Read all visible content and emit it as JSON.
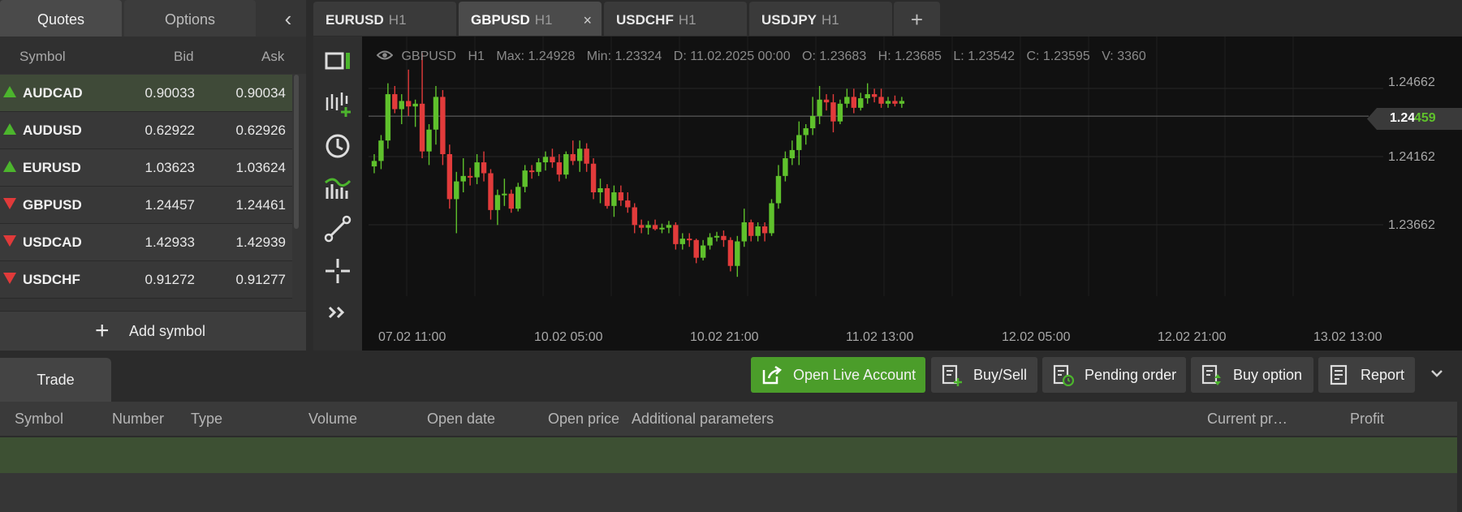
{
  "quotes": {
    "tabs": [
      "Quotes",
      "Options"
    ],
    "columns": {
      "symbol": "Symbol",
      "bid": "Bid",
      "ask": "Ask"
    },
    "rows": [
      {
        "symbol": "AUDCAD",
        "bid": "0.90033",
        "ask": "0.90034",
        "dir": "up"
      },
      {
        "symbol": "AUDUSD",
        "bid": "0.62922",
        "ask": "0.62926",
        "dir": "up"
      },
      {
        "symbol": "EURUSD",
        "bid": "1.03623",
        "ask": "1.03624",
        "dir": "up"
      },
      {
        "symbol": "GBPUSD",
        "bid": "1.24457",
        "ask": "1.24461",
        "dir": "down"
      },
      {
        "symbol": "USDCAD",
        "bid": "1.42933",
        "ask": "1.42939",
        "dir": "down"
      },
      {
        "symbol": "USDCHF",
        "bid": "0.91272",
        "ask": "0.91277",
        "dir": "down"
      }
    ],
    "add_symbol": "Add symbol"
  },
  "chart_tabs": [
    {
      "symbol": "EURUSD",
      "tf": "H1"
    },
    {
      "symbol": "GBPUSD",
      "tf": "H1",
      "active": true
    },
    {
      "symbol": "USDCHF",
      "tf": "H1"
    },
    {
      "symbol": "USDJPY",
      "tf": "H1"
    }
  ],
  "toolbar_icons": [
    "chart-type-icon",
    "add-indicator-icon",
    "timeframe-icon",
    "indicators-icon",
    "line-tool-icon",
    "crosshair-icon",
    "more-icon"
  ],
  "chart": {
    "info": {
      "symbol": "GBPUSD",
      "tf": "H1",
      "max": "Max: 1.24928",
      "min": "Min: 1.23324",
      "date": "D: 11.02.2025 00:00",
      "open": "O: 1.23683",
      "high": "H: 1.23685",
      "low": "L: 1.23542",
      "close": "C: 1.23595",
      "volume": "V: 3360"
    },
    "price_labels": [
      "1.24662",
      "1.24162",
      "1.23662"
    ],
    "current_price_main": "1.24",
    "current_price_tail": "459",
    "time_labels": [
      "07.02 11:00",
      "10.02 05:00",
      "10.02 21:00",
      "11.02 13:00",
      "12.02 05:00",
      "12.02 21:00",
      "13.02 13:00"
    ],
    "colors": {
      "up": "#5fc12c",
      "down": "#e23b3b",
      "bg": "#111111"
    }
  },
  "chart_data": {
    "type": "candlestick",
    "title": "",
    "ylim": [
      1.232,
      1.2495
    ],
    "yticks": [
      1.24662,
      1.24162,
      1.23662
    ],
    "current_price": 1.24459,
    "candles": [
      {
        "o": 1.2409,
        "h": 1.2418,
        "l": 1.2404,
        "c": 1.2413
      },
      {
        "o": 1.2413,
        "h": 1.2432,
        "l": 1.2407,
        "c": 1.2428
      },
      {
        "o": 1.2428,
        "h": 1.247,
        "l": 1.2422,
        "c": 1.2462
      },
      {
        "o": 1.2462,
        "h": 1.2468,
        "l": 1.2448,
        "c": 1.2451
      },
      {
        "o": 1.2451,
        "h": 1.2462,
        "l": 1.244,
        "c": 1.2457
      },
      {
        "o": 1.2457,
        "h": 1.248,
        "l": 1.2446,
        "c": 1.2453
      },
      {
        "o": 1.2453,
        "h": 1.2458,
        "l": 1.2438,
        "c": 1.2455
      },
      {
        "o": 1.2455,
        "h": 1.2492,
        "l": 1.2415,
        "c": 1.242
      },
      {
        "o": 1.242,
        "h": 1.244,
        "l": 1.241,
        "c": 1.2436
      },
      {
        "o": 1.2436,
        "h": 1.2468,
        "l": 1.2425,
        "c": 1.246
      },
      {
        "o": 1.246,
        "h": 1.2465,
        "l": 1.241,
        "c": 1.2418
      },
      {
        "o": 1.2418,
        "h": 1.2425,
        "l": 1.2378,
        "c": 1.2385
      },
      {
        "o": 1.2385,
        "h": 1.2405,
        "l": 1.236,
        "c": 1.2398
      },
      {
        "o": 1.2398,
        "h": 1.2415,
        "l": 1.239,
        "c": 1.2402
      },
      {
        "o": 1.2402,
        "h": 1.2408,
        "l": 1.2395,
        "c": 1.2401
      },
      {
        "o": 1.2401,
        "h": 1.2418,
        "l": 1.2396,
        "c": 1.2412
      },
      {
        "o": 1.2412,
        "h": 1.242,
        "l": 1.2398,
        "c": 1.2404
      },
      {
        "o": 1.2404,
        "h": 1.2407,
        "l": 1.237,
        "c": 1.2377
      },
      {
        "o": 1.2377,
        "h": 1.2392,
        "l": 1.2366,
        "c": 1.2388
      },
      {
        "o": 1.2388,
        "h": 1.24,
        "l": 1.238,
        "c": 1.2389
      },
      {
        "o": 1.2389,
        "h": 1.2392,
        "l": 1.2375,
        "c": 1.2378
      },
      {
        "o": 1.2378,
        "h": 1.2397,
        "l": 1.2376,
        "c": 1.2394
      },
      {
        "o": 1.2394,
        "h": 1.241,
        "l": 1.239,
        "c": 1.2406
      },
      {
        "o": 1.2406,
        "h": 1.241,
        "l": 1.24,
        "c": 1.2405
      },
      {
        "o": 1.2405,
        "h": 1.2415,
        "l": 1.2402,
        "c": 1.2412
      },
      {
        "o": 1.2412,
        "h": 1.242,
        "l": 1.2406,
        "c": 1.2416
      },
      {
        "o": 1.2416,
        "h": 1.2422,
        "l": 1.2408,
        "c": 1.2412
      },
      {
        "o": 1.2412,
        "h": 1.2418,
        "l": 1.2398,
        "c": 1.2403
      },
      {
        "o": 1.2403,
        "h": 1.242,
        "l": 1.24,
        "c": 1.2418
      },
      {
        "o": 1.2418,
        "h": 1.2428,
        "l": 1.241,
        "c": 1.2413
      },
      {
        "o": 1.2413,
        "h": 1.2428,
        "l": 1.2405,
        "c": 1.2422
      },
      {
        "o": 1.2422,
        "h": 1.2426,
        "l": 1.2405,
        "c": 1.2411
      },
      {
        "o": 1.2411,
        "h": 1.2415,
        "l": 1.2385,
        "c": 1.239
      },
      {
        "o": 1.239,
        "h": 1.24,
        "l": 1.2382,
        "c": 1.2393
      },
      {
        "o": 1.2393,
        "h": 1.2396,
        "l": 1.2378,
        "c": 1.238
      },
      {
        "o": 1.238,
        "h": 1.2395,
        "l": 1.2372,
        "c": 1.239
      },
      {
        "o": 1.239,
        "h": 1.2395,
        "l": 1.238,
        "c": 1.2384
      },
      {
        "o": 1.2384,
        "h": 1.239,
        "l": 1.2375,
        "c": 1.2379
      },
      {
        "o": 1.2379,
        "h": 1.2382,
        "l": 1.236,
        "c": 1.2366
      },
      {
        "o": 1.2366,
        "h": 1.237,
        "l": 1.236,
        "c": 1.2364
      },
      {
        "o": 1.2364,
        "h": 1.2369,
        "l": 1.2359,
        "c": 1.2366
      },
      {
        "o": 1.2366,
        "h": 1.237,
        "l": 1.2362,
        "c": 1.2363
      },
      {
        "o": 1.2363,
        "h": 1.2367,
        "l": 1.236,
        "c": 1.2364
      },
      {
        "o": 1.2364,
        "h": 1.2369,
        "l": 1.236,
        "c": 1.2366
      },
      {
        "o": 1.2366,
        "h": 1.2368,
        "l": 1.2348,
        "c": 1.2352
      },
      {
        "o": 1.2352,
        "h": 1.236,
        "l": 1.2348,
        "c": 1.2356
      },
      {
        "o": 1.2356,
        "h": 1.236,
        "l": 1.235,
        "c": 1.2355
      },
      {
        "o": 1.2355,
        "h": 1.2356,
        "l": 1.2338,
        "c": 1.2342
      },
      {
        "o": 1.2342,
        "h": 1.2355,
        "l": 1.234,
        "c": 1.2351
      },
      {
        "o": 1.2351,
        "h": 1.236,
        "l": 1.2348,
        "c": 1.2357
      },
      {
        "o": 1.2357,
        "h": 1.2361,
        "l": 1.2354,
        "c": 1.2358
      },
      {
        "o": 1.2358,
        "h": 1.2362,
        "l": 1.235,
        "c": 1.2355
      },
      {
        "o": 1.2355,
        "h": 1.2357,
        "l": 1.2332,
        "c": 1.2336
      },
      {
        "o": 1.2336,
        "h": 1.2358,
        "l": 1.2328,
        "c": 1.2354
      },
      {
        "o": 1.2354,
        "h": 1.2378,
        "l": 1.235,
        "c": 1.2368
      },
      {
        "o": 1.2368,
        "h": 1.237,
        "l": 1.2354,
        "c": 1.2358
      },
      {
        "o": 1.2358,
        "h": 1.2368,
        "l": 1.2354,
        "c": 1.2365
      },
      {
        "o": 1.2365,
        "h": 1.2368,
        "l": 1.2354,
        "c": 1.236
      },
      {
        "o": 1.236,
        "h": 1.2385,
        "l": 1.2358,
        "c": 1.2382
      },
      {
        "o": 1.2382,
        "h": 1.241,
        "l": 1.2378,
        "c": 1.2402
      },
      {
        "o": 1.2402,
        "h": 1.242,
        "l": 1.2398,
        "c": 1.2415
      },
      {
        "o": 1.2415,
        "h": 1.2428,
        "l": 1.241,
        "c": 1.2421
      },
      {
        "o": 1.2421,
        "h": 1.2442,
        "l": 1.241,
        "c": 1.2432
      },
      {
        "o": 1.2432,
        "h": 1.244,
        "l": 1.2425,
        "c": 1.2437
      },
      {
        "o": 1.2437,
        "h": 1.246,
        "l": 1.2432,
        "c": 1.2446
      },
      {
        "o": 1.2446,
        "h": 1.2468,
        "l": 1.244,
        "c": 1.2458
      },
      {
        "o": 1.2458,
        "h": 1.2462,
        "l": 1.245,
        "c": 1.2456
      },
      {
        "o": 1.2456,
        "h": 1.2462,
        "l": 1.2434,
        "c": 1.2442
      },
      {
        "o": 1.2442,
        "h": 1.2458,
        "l": 1.244,
        "c": 1.2455
      },
      {
        "o": 1.2455,
        "h": 1.2466,
        "l": 1.2452,
        "c": 1.246
      },
      {
        "o": 1.246,
        "h": 1.2466,
        "l": 1.2448,
        "c": 1.2452
      },
      {
        "o": 1.2452,
        "h": 1.2463,
        "l": 1.245,
        "c": 1.2459
      },
      {
        "o": 1.2459,
        "h": 1.247,
        "l": 1.2455,
        "c": 1.2462
      },
      {
        "o": 1.2462,
        "h": 1.2466,
        "l": 1.2456,
        "c": 1.246
      },
      {
        "o": 1.246,
        "h": 1.2466,
        "l": 1.2452,
        "c": 1.2455
      },
      {
        "o": 1.2455,
        "h": 1.246,
        "l": 1.2452,
        "c": 1.2457
      },
      {
        "o": 1.2457,
        "h": 1.2461,
        "l": 1.2453,
        "c": 1.2455
      },
      {
        "o": 1.2455,
        "h": 1.246,
        "l": 1.2452,
        "c": 1.2457
      }
    ]
  },
  "bottom": {
    "trade_tab": "Trade",
    "buttons": [
      {
        "label": "Open Live Account",
        "icon": "external-link-icon"
      },
      {
        "label": "Buy/Sell",
        "icon": "add-order-icon"
      },
      {
        "label": "Pending order",
        "icon": "pending-order-icon"
      },
      {
        "label": "Buy option",
        "icon": "option-icon"
      },
      {
        "label": "Report",
        "icon": "report-icon"
      }
    ],
    "columns": [
      "Symbol",
      "Number",
      "Type",
      "Volume",
      "Open date",
      "Open price",
      "Additional parameters",
      "Current pr…",
      "Profit"
    ]
  }
}
